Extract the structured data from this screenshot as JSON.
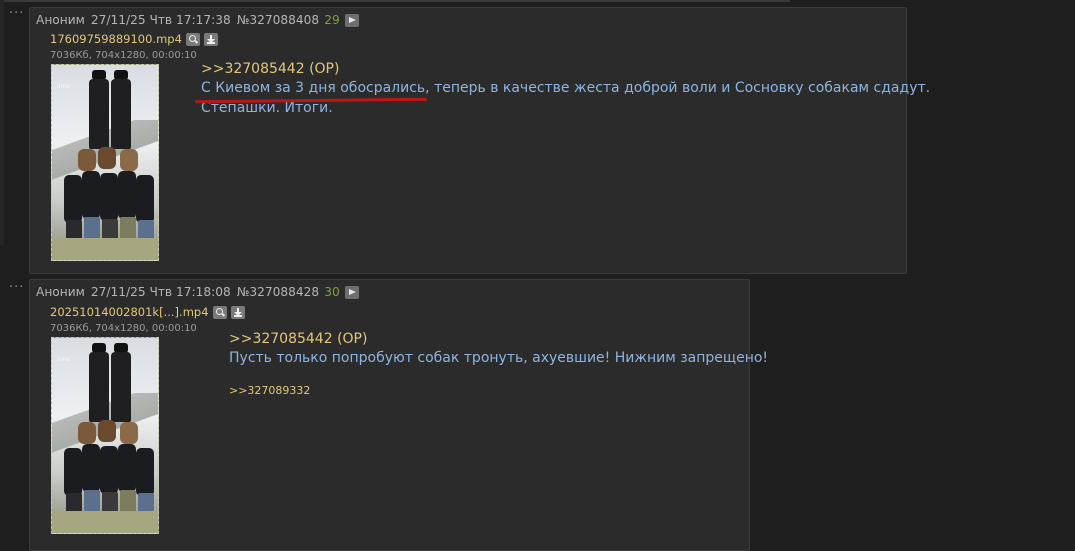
{
  "posts": [
    {
      "name": "Аноним",
      "date": "27/11/25 Чтв 17:17:38",
      "number": "№327088408",
      "count": "29",
      "file": {
        "name": "17609759889100.mp4",
        "meta": "7036Кб, 704x1280, 00:00:10",
        "watermark": "lime"
      },
      "reply_link": ">>327085442 (OP)",
      "text_underlined": "С Киевом за 3 дня обосрались",
      "text_rest": ", теперь в качестве жеста доброй воли и Сосновку собакам сдадут.",
      "text_line2": "Степашки. Итоги."
    },
    {
      "name": "Аноним",
      "date": "27/11/25 Чтв 17:18:08",
      "number": "№327088428",
      "count": "30",
      "file": {
        "name": "20251014002801k[...].mp4",
        "meta": "7036Кб, 704x1280, 00:00:10",
        "watermark": "lime"
      },
      "reply_link": ">>327085442 (OP)",
      "text": "Пусть только попробуют собак тронуть, ахуевшие! Нижним запрещено!",
      "backlink": ">>327089332"
    }
  ],
  "colors": {
    "background": "#1e1e1e",
    "post_bg": "#2b2b2b",
    "reply_link": "#e4c779",
    "post_text": "#8eb5e0",
    "post_count": "#7fa33c",
    "underline_mark": "#c01515"
  },
  "icons": [
    "dots-icon",
    "play-icon",
    "magnify-icon",
    "download-icon"
  ]
}
